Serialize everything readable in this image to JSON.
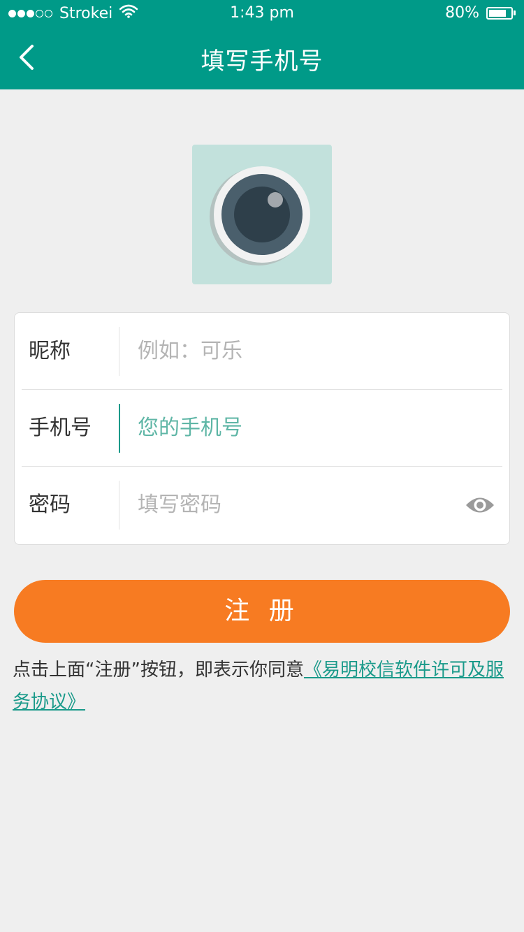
{
  "status_bar": {
    "signal_full": 3,
    "signal_empty": 2,
    "carrier": "Strokei",
    "time": "1:43 pm",
    "battery_text": "80%",
    "battery_level": 0.8,
    "icons": [
      "signal-dots-icon",
      "wifi-icon",
      "battery-icon"
    ]
  },
  "nav": {
    "title": "填写手机号",
    "back_icon": "chevron-left-icon"
  },
  "avatar": {
    "icon": "camera-icon",
    "bg_color": "#c2e1dc"
  },
  "form": {
    "nickname": {
      "label": "昵称",
      "placeholder": "例如：可乐"
    },
    "phone": {
      "label": "手机号",
      "placeholder": "您的手机号"
    },
    "password": {
      "label": "密码",
      "placeholder": "填写密码",
      "toggle_icon": "eye-icon"
    }
  },
  "register_button": {
    "label": "注 册"
  },
  "agreement": {
    "prefix": "点击上面“注册”按钮，即表示你同意",
    "link_text": "《易明校信软件许可及服务协议》"
  },
  "colors": {
    "primary": "#009a88",
    "accent_orange": "#f77b22",
    "link": "#1a9a8a",
    "page_bg": "#efefef"
  }
}
